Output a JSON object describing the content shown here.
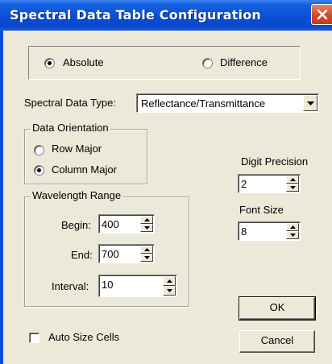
{
  "window": {
    "title": "Spectral Data Table Configuration"
  },
  "mode": {
    "options": [
      "Absolute",
      "Difference"
    ],
    "selected": "Absolute"
  },
  "data_type": {
    "label": "Spectral Data Type:",
    "value": "Reflectance/Transmittance"
  },
  "orientation": {
    "title": "Data Orientation",
    "options": [
      "Row Major",
      "Column Major"
    ],
    "selected": "Column Major"
  },
  "wavelength": {
    "title": "Wavelength Range",
    "begin_label": "Begin:",
    "begin_value": "400",
    "end_label": "End:",
    "end_value": "700",
    "interval_label": "Interval:",
    "interval_value": "10"
  },
  "precision": {
    "label": "Digit Precision",
    "value": "2"
  },
  "font_size": {
    "label": "Font Size",
    "value": "8"
  },
  "auto_size": {
    "label": "Auto Size Cells",
    "checked": false
  },
  "buttons": {
    "ok": "OK",
    "cancel": "Cancel"
  }
}
